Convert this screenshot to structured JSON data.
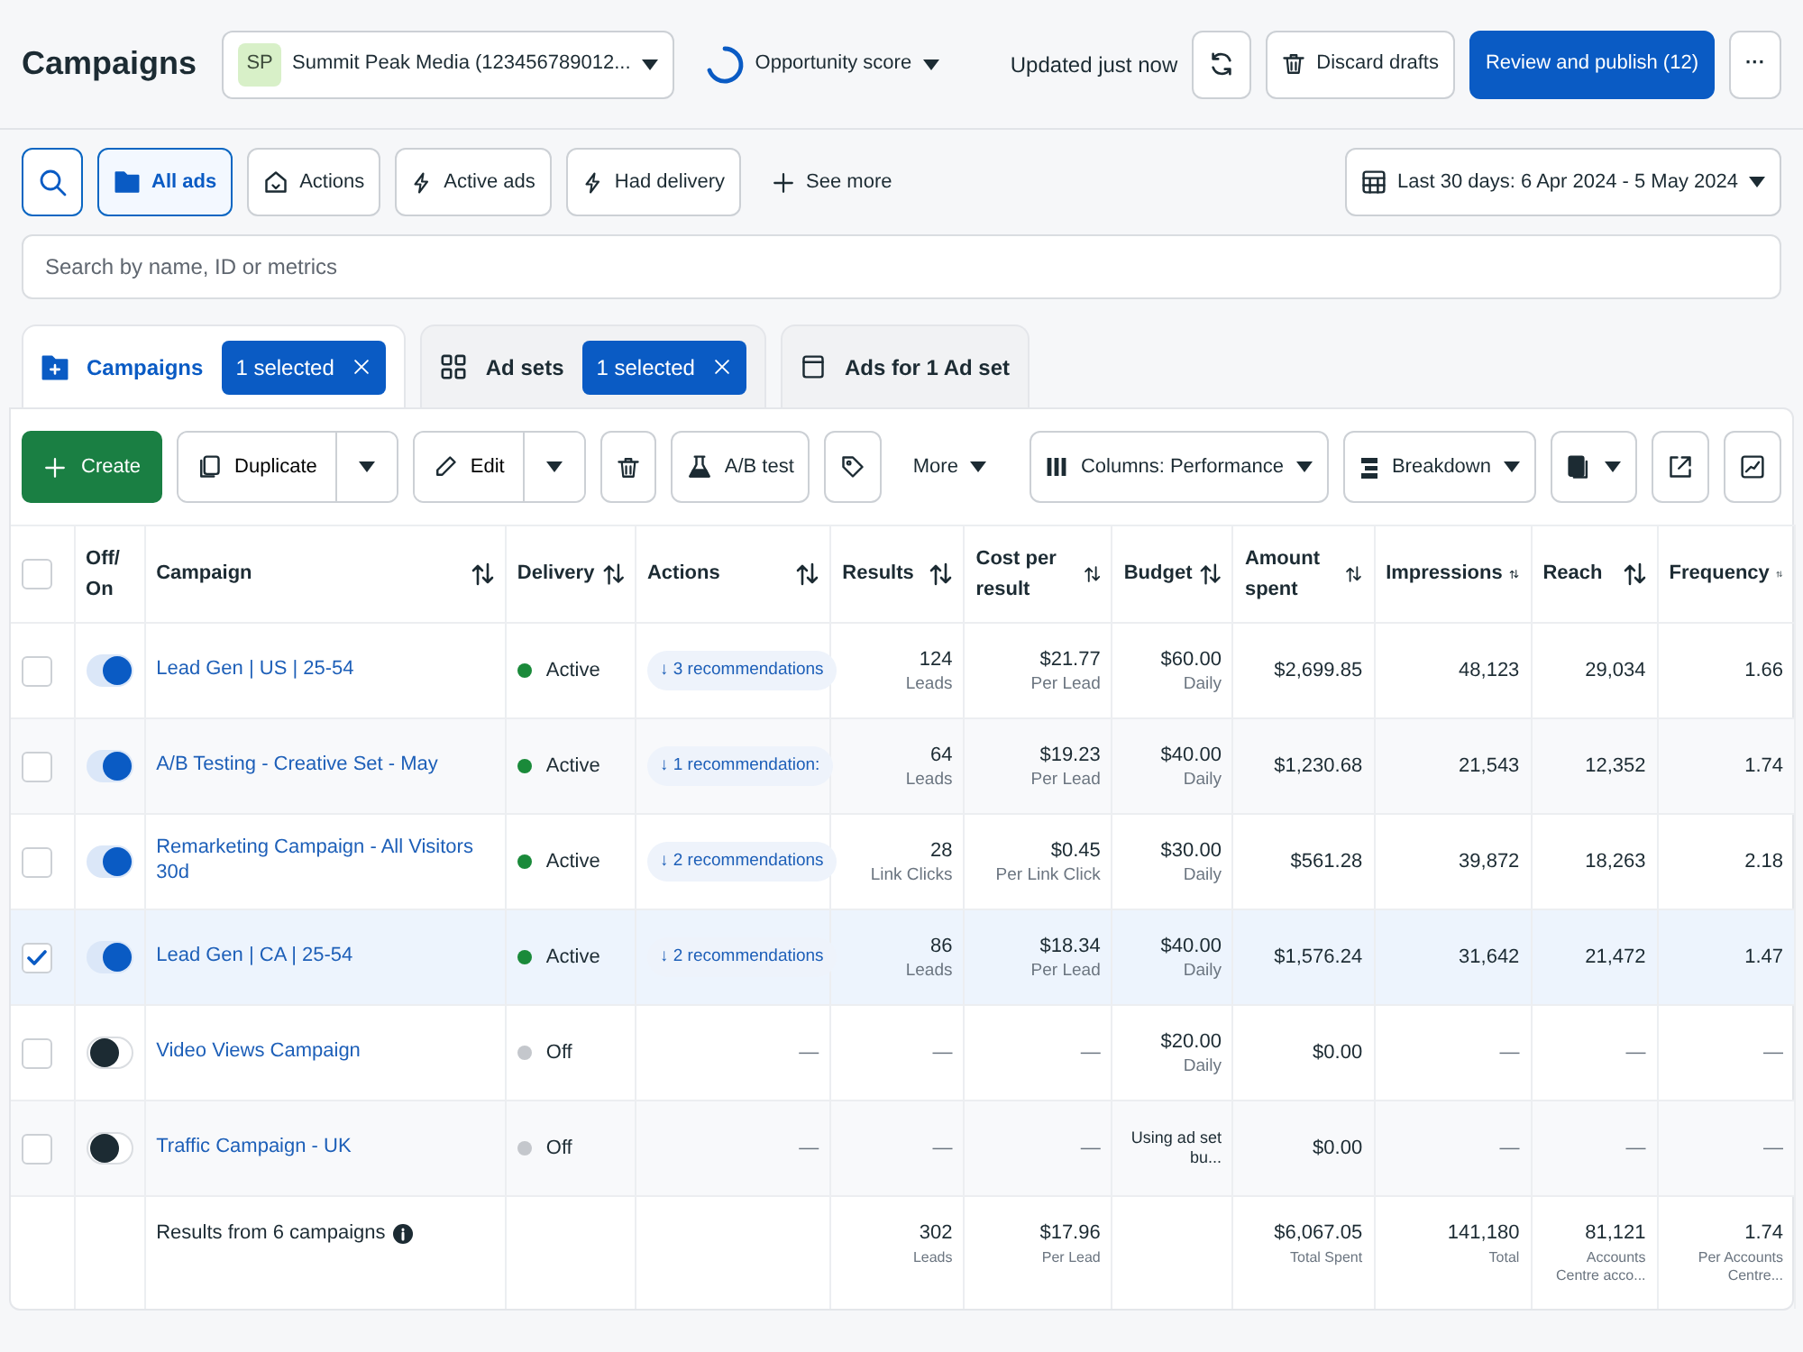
{
  "header": {
    "title": "Campaigns",
    "account": {
      "initials": "SP",
      "name": "Summit Peak Media (123456789012..."
    },
    "opportunity_score": "Opportunity score",
    "updated": "Updated just now",
    "discard": "Discard drafts",
    "publish": "Review and publish (12)",
    "more": "···"
  },
  "filters": [
    {
      "label": "All ads",
      "selected": true
    },
    {
      "label": "Actions",
      "selected": false
    },
    {
      "label": "Active ads",
      "selected": false
    },
    {
      "label": "Had delivery",
      "selected": false
    }
  ],
  "see_more": "See more",
  "date_range": "Last 30 days: 6 Apr 2024 - 5 May 2024",
  "search": {
    "placeholder": "Search by name, ID or metrics"
  },
  "level_tabs": [
    {
      "label": "Campaigns",
      "selected": true,
      "badge": "1 selected"
    },
    {
      "label": "Ad sets",
      "selected": false,
      "badge": "1 selected"
    },
    {
      "label": "Ads for 1 Ad set",
      "selected": false
    }
  ],
  "toolbar": {
    "create": "Create",
    "duplicate": "Duplicate",
    "edit": "Edit",
    "ab_test": "A/B test",
    "more": "More",
    "columns": "Columns: Performance",
    "breakdown": "Breakdown"
  },
  "table": {
    "header_checked": false,
    "columns": [
      {
        "label": "Off/ On",
        "sortable": false
      },
      {
        "label": "Campaign",
        "sortable": true
      },
      {
        "label": "Delivery",
        "sortable": true
      },
      {
        "label": "Actions",
        "sortable": true
      },
      {
        "label": "Results",
        "sortable": true
      },
      {
        "label": "Cost per result",
        "sortable": true
      },
      {
        "label": "Budget",
        "sortable": true
      },
      {
        "label": "Amount spent",
        "sortable": true
      },
      {
        "label": "Impressions",
        "sortable": true
      },
      {
        "label": "Reach",
        "sortable": true
      },
      {
        "label": "Frequency",
        "sortable": true
      }
    ],
    "rows": [
      {
        "checked": false,
        "on": true,
        "campaign": "Lead Gen | US | 25-54",
        "delivery": {
          "label": "Active",
          "color": "#1a8a3a"
        },
        "actions": {
          "kind": "recommendations",
          "label": "↓ 3 recommendations"
        },
        "results": {
          "value": "124",
          "caption": "Leads"
        },
        "cost": {
          "value": "$21.77",
          "caption": "Per Lead"
        },
        "budget": {
          "value": "$60.00",
          "caption": "Daily"
        },
        "amount_spent": {
          "value": "$2,699.85"
        },
        "impressions": {
          "value": "48,123"
        },
        "reach": {
          "value": "29,034"
        },
        "frequency": {
          "value": "1.66"
        }
      },
      {
        "checked": false,
        "on": true,
        "campaign": "A/B Testing - Creative Set - May",
        "delivery": {
          "label": "Active",
          "color": "#1a8a3a"
        },
        "actions": {
          "kind": "recommendations",
          "label": "↓ 1 recommendation:"
        },
        "results": {
          "value": "64",
          "caption": "Leads"
        },
        "cost": {
          "value": "$19.23",
          "caption": "Per Lead"
        },
        "budget": {
          "value": "$40.00",
          "caption": "Daily"
        },
        "amount_spent": {
          "value": "$1,230.68"
        },
        "impressions": {
          "value": "21,543"
        },
        "reach": {
          "value": "12,352"
        },
        "frequency": {
          "value": "1.74"
        }
      },
      {
        "checked": false,
        "on": true,
        "campaign": "Remarketing Campaign - All Visitors 30d",
        "delivery": {
          "label": "Active",
          "color": "#1a8a3a"
        },
        "actions": {
          "kind": "recommendations",
          "label": "↓ 2 recommendations"
        },
        "results": {
          "value": "28",
          "caption": "Link Clicks"
        },
        "cost": {
          "value": "$0.45",
          "caption": "Per Link Click"
        },
        "budget": {
          "value": "$30.00",
          "caption": "Daily"
        },
        "amount_spent": {
          "value": "$561.28"
        },
        "impressions": {
          "value": "39,872"
        },
        "reach": {
          "value": "18,263"
        },
        "frequency": {
          "value": "2.18"
        }
      },
      {
        "checked": true,
        "on": true,
        "campaign": "Lead Gen | CA | 25-54",
        "delivery": {
          "label": "Active",
          "color": "#1a8a3a"
        },
        "actions": {
          "kind": "recommendations",
          "label": "↓ 2 recommendations"
        },
        "results": {
          "value": "86",
          "caption": "Leads"
        },
        "cost": {
          "value": "$18.34",
          "caption": "Per Lead"
        },
        "budget": {
          "value": "$40.00",
          "caption": "Daily"
        },
        "amount_spent": {
          "value": "$1,576.24"
        },
        "impressions": {
          "value": "31,642"
        },
        "reach": {
          "value": "21,472"
        },
        "frequency": {
          "value": "1.47"
        }
      },
      {
        "checked": false,
        "on": false,
        "campaign": "Video Views Campaign",
        "delivery": {
          "label": "Off",
          "color": "#c4c7cc"
        },
        "actions": {
          "kind": "empty",
          "label": "—"
        },
        "results": {
          "value": "—"
        },
        "cost": {
          "value": "—"
        },
        "budget": {
          "value": "$20.00",
          "caption": "Daily"
        },
        "amount_spent": {
          "value": "$0.00"
        },
        "impressions": {
          "value": "—"
        },
        "reach": {
          "value": "—"
        },
        "frequency": {
          "value": "—"
        }
      },
      {
        "checked": false,
        "on": false,
        "campaign": "Traffic Campaign - UK",
        "delivery": {
          "label": "Off",
          "color": "#c4c7cc"
        },
        "actions": {
          "kind": "empty",
          "label": "—"
        },
        "results": {
          "value": "—"
        },
        "cost": {
          "value": "—"
        },
        "budget": {
          "note": "Using ad set bu..."
        },
        "amount_spent": {
          "value": "$0.00"
        },
        "impressions": {
          "value": "—"
        },
        "reach": {
          "value": "—"
        },
        "frequency": {
          "value": "—"
        }
      }
    ],
    "footer": {
      "label": "Results from 6 campaigns",
      "results": {
        "value": "302",
        "caption": "Leads"
      },
      "cost": {
        "value": "$17.96",
        "caption": "Per Lead"
      },
      "amount_spent": {
        "value": "$6,067.05",
        "caption": "Total Spent"
      },
      "impressions": {
        "value": "141,180",
        "caption": "Total"
      },
      "reach": {
        "value": "81,121",
        "caption": "Accounts Centre acco..."
      },
      "frequency": {
        "value": "1.74",
        "caption": "Per Accounts Centre..."
      }
    }
  }
}
